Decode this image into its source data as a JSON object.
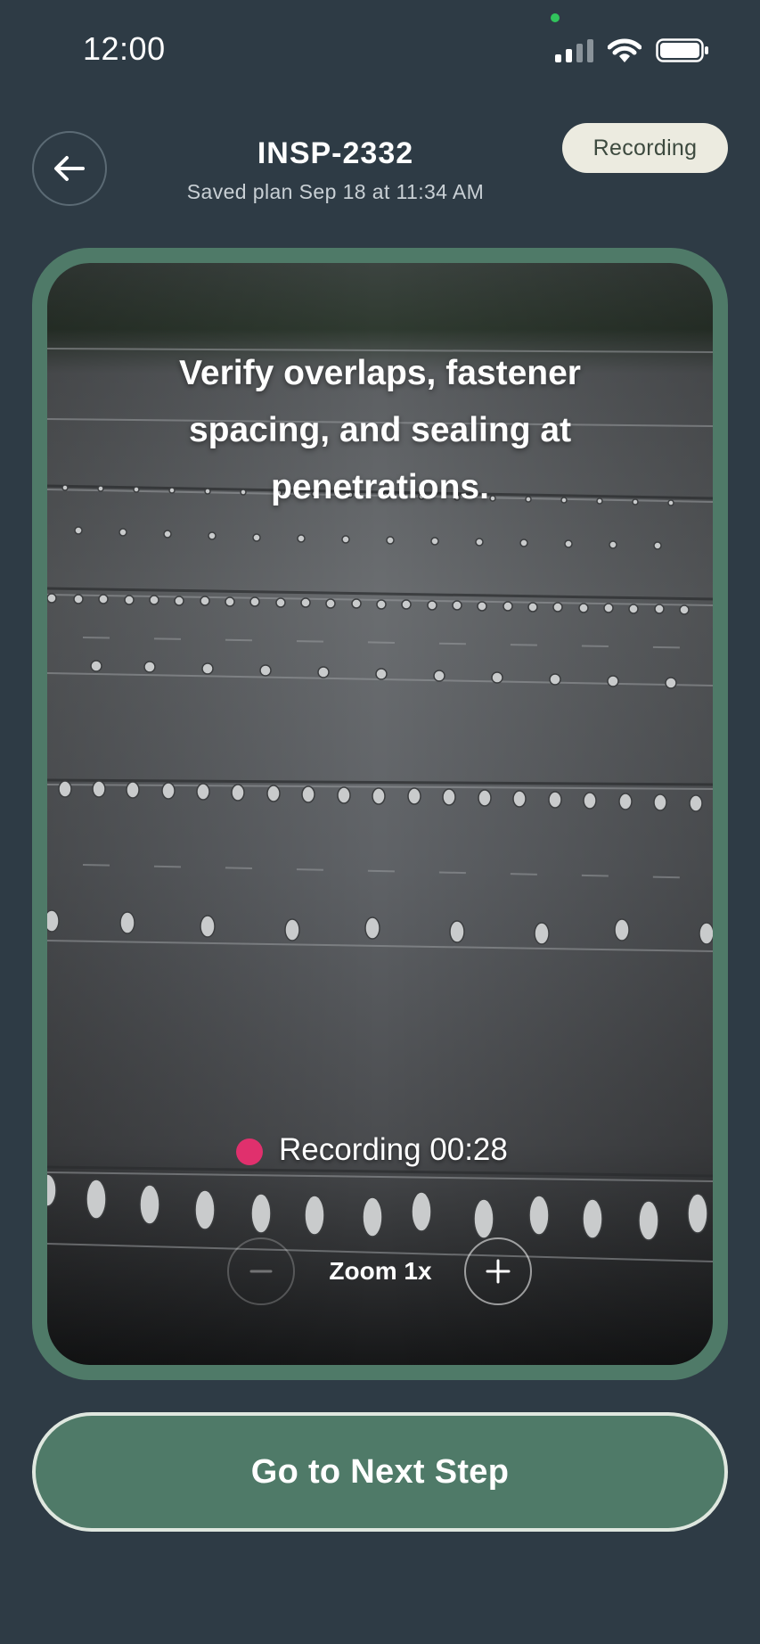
{
  "status_bar": {
    "time": "12:00",
    "icons": [
      "camera-active-dot",
      "signal-icon",
      "wifi-icon",
      "battery-icon"
    ]
  },
  "header": {
    "back_icon": "arrow-left-icon",
    "title": "INSP-2332",
    "subtitle": "Saved plan Sep 18 at 11:34 AM",
    "badge": "Recording"
  },
  "camera": {
    "instruction": "Verify overlaps, fastener spacing, and sealing at penetrations.",
    "recording_label": "Recording 00:28",
    "zoom_label": "Zoom 1x",
    "zoom_minus_icon": "minus-icon",
    "zoom_plus_icon": "plus-icon"
  },
  "footer": {
    "next_label": "Go to Next Step"
  },
  "colors": {
    "background": "#2e3b45",
    "accent_green": "#4f7a68",
    "badge_bg": "#ecebe0",
    "record_dot": "#e0306d"
  }
}
